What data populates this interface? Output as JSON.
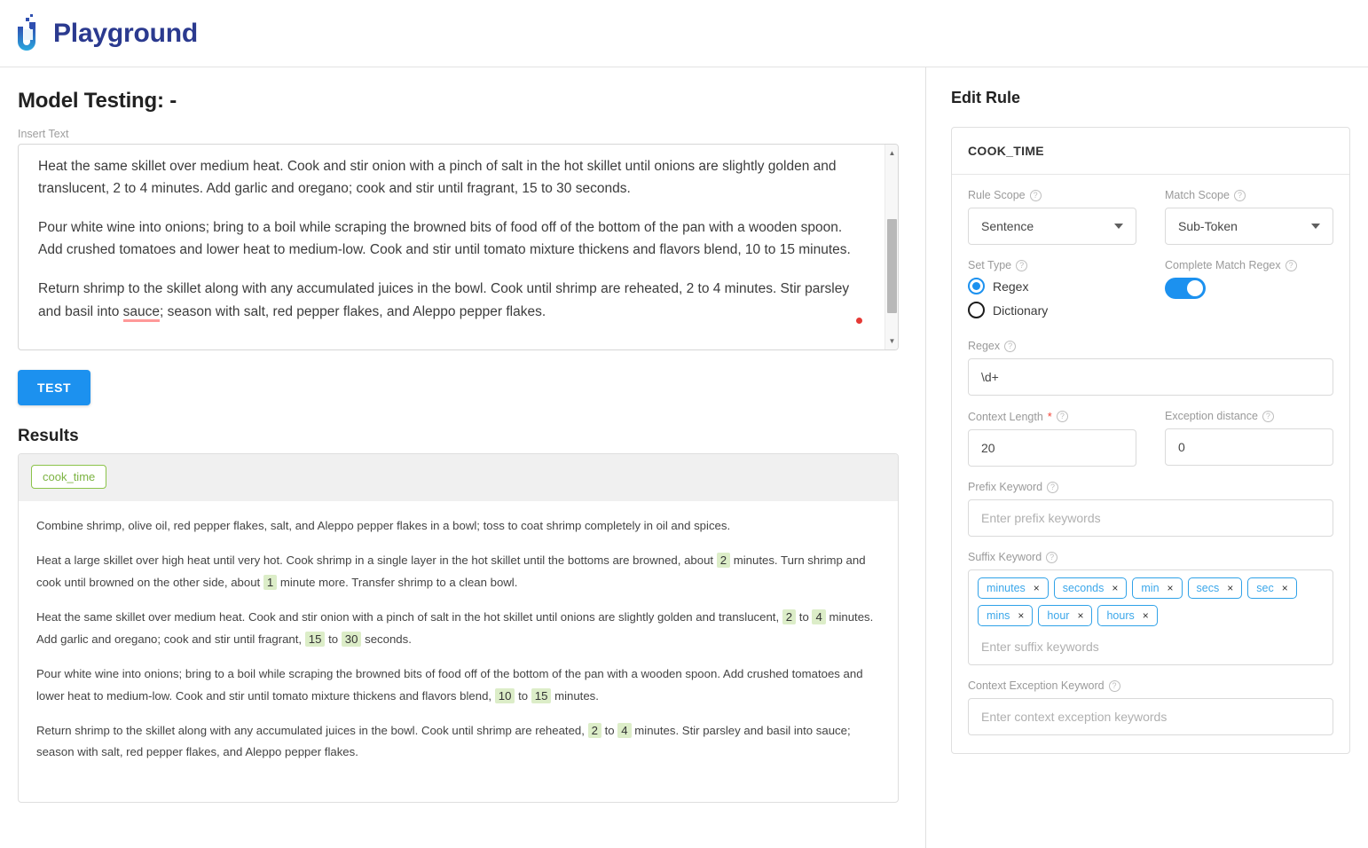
{
  "header": {
    "brand": "Playground",
    "logo_icon": "playground-u-logo"
  },
  "left": {
    "page_title": "Model Testing: -",
    "insert_text_label": "Insert Text",
    "insert_text_paragraphs": [
      "Heat the same skillet over medium heat. Cook and stir onion with a pinch of salt in the hot skillet until onions are slightly golden and translucent, 2 to 4 minutes. Add garlic and oregano; cook and stir until fragrant, 15 to 30 seconds.",
      "Pour white wine into onions; bring to a boil while scraping the browned bits of food off of the bottom of the pan with a wooden spoon. Add crushed tomatoes and lower heat to medium-low. Cook and stir until tomato mixture thickens and flavors blend, 10 to 15 minutes."
    ],
    "insert_text_last_pre": "Return shrimp to the skillet along with any accumulated juices in the bowl. Cook until shrimp are reheated, 2 to 4 minutes. Stir parsley and basil into ",
    "insert_text_misspelled": "sauce",
    "insert_text_last_post": "; season with salt, red pepper flakes, and Aleppo pepper flakes.",
    "test_button": "TEST",
    "results_title": "Results",
    "entity_chip": "cook_time",
    "results_paragraphs": [
      [
        {
          "t": "Combine shrimp, olive oil, red pepper flakes, salt, and Aleppo pepper flakes in a bowl; toss to coat shrimp completely in oil and spices.",
          "hl": false
        }
      ],
      [
        {
          "t": "Heat a large skillet over high heat until very hot. Cook shrimp in a single layer in the hot skillet until the bottoms are browned, about ",
          "hl": false
        },
        {
          "t": "2",
          "hl": true
        },
        {
          "t": " minutes. Turn shrimp and cook until browned on the other side, about ",
          "hl": false
        },
        {
          "t": "1",
          "hl": true
        },
        {
          "t": " minute more. Transfer shrimp to a clean bowl.",
          "hl": false
        }
      ],
      [
        {
          "t": "Heat the same skillet over medium heat. Cook and stir onion with a pinch of salt in the hot skillet until onions are slightly golden and translucent, ",
          "hl": false
        },
        {
          "t": "2",
          "hl": true
        },
        {
          "t": " to ",
          "hl": false
        },
        {
          "t": "4",
          "hl": true
        },
        {
          "t": " minutes. Add garlic and oregano; cook and stir until fragrant, ",
          "hl": false
        },
        {
          "t": "15",
          "hl": true
        },
        {
          "t": " to ",
          "hl": false
        },
        {
          "t": "30",
          "hl": true
        },
        {
          "t": " seconds.",
          "hl": false
        }
      ],
      [
        {
          "t": "Pour white wine into onions; bring to a boil while scraping the browned bits of food off of the bottom of the pan with a wooden spoon. Add crushed tomatoes and lower heat to medium-low. Cook and stir until tomato mixture thickens and flavors blend, ",
          "hl": false
        },
        {
          "t": "10",
          "hl": true
        },
        {
          "t": " to ",
          "hl": false
        },
        {
          "t": "15",
          "hl": true
        },
        {
          "t": " minutes.",
          "hl": false
        }
      ],
      [
        {
          "t": "Return shrimp to the skillet along with any accumulated juices in the bowl. Cook until shrimp are reheated, ",
          "hl": false
        },
        {
          "t": "2",
          "hl": true
        },
        {
          "t": " to ",
          "hl": false
        },
        {
          "t": "4",
          "hl": true
        },
        {
          "t": " minutes. Stir parsley and basil into sauce; season with salt, red pepper flakes, and Aleppo pepper flakes.",
          "hl": false
        }
      ]
    ]
  },
  "right": {
    "panel_title": "Edit Rule",
    "rule_name": "COOK_TIME",
    "rule_scope": {
      "label": "Rule Scope",
      "value": "Sentence"
    },
    "match_scope": {
      "label": "Match Scope",
      "value": "Sub-Token"
    },
    "set_type": {
      "label": "Set Type",
      "options": [
        "Regex",
        "Dictionary"
      ],
      "selected": "Regex"
    },
    "complete_match_regex": {
      "label": "Complete Match Regex",
      "enabled": true
    },
    "regex": {
      "label": "Regex",
      "value": "\\d+"
    },
    "context_length": {
      "label": "Context Length",
      "required": true,
      "value": "20"
    },
    "exception_distance": {
      "label": "Exception distance",
      "value": "0"
    },
    "prefix_keyword": {
      "label": "Prefix Keyword",
      "placeholder": "Enter prefix keywords",
      "chips": []
    },
    "suffix_keyword": {
      "label": "Suffix Keyword",
      "placeholder": "Enter suffix keywords",
      "chips": [
        "minutes",
        "seconds",
        "min",
        "secs",
        "sec",
        "mins",
        "hour",
        "hours"
      ]
    },
    "context_exception_keyword": {
      "label": "Context Exception Keyword",
      "placeholder": "Enter context exception keywords"
    },
    "help_icon": "help-circle-icon",
    "remove_icon": "close-x-icon"
  },
  "colors": {
    "brand_blue": "#2b3a8f",
    "accent_blue": "#1c91ef",
    "chip_green": "#8bc34a",
    "highlight_green": "#dcedc8",
    "error_red": "#f44336"
  }
}
